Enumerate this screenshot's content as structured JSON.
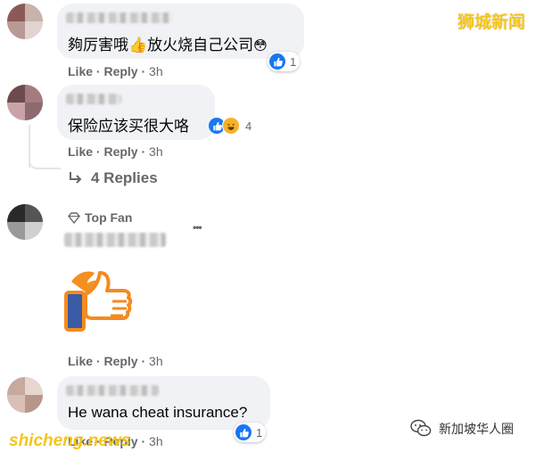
{
  "watermark": {
    "top": "狮城新闻",
    "bottom": "shicheng.news",
    "wechat": "新加坡华人圈"
  },
  "comments": [
    {
      "text": "夠厉害哦",
      "text2": "放火烧自己公司",
      "like": "Like",
      "reply": "Reply",
      "time": "3h",
      "reaction_count": "1"
    },
    {
      "text": "保险应该买很大咯",
      "like": "Like",
      "reply": "Reply",
      "time": "3h",
      "reaction_count": "4",
      "replies_label": "4 Replies"
    },
    {
      "badge": "Top Fan",
      "like": "Like",
      "reply": "Reply",
      "time": "3h",
      "more": "•••"
    },
    {
      "text": "He wana cheat insurance?",
      "like": "Like",
      "reply": "Reply",
      "time": "3h",
      "reaction_count": "1"
    }
  ],
  "colors": {
    "like_blue": "#1877f2",
    "bubble": "#f0f2f5",
    "meta": "#65676b",
    "watermark": "#f5c518"
  }
}
